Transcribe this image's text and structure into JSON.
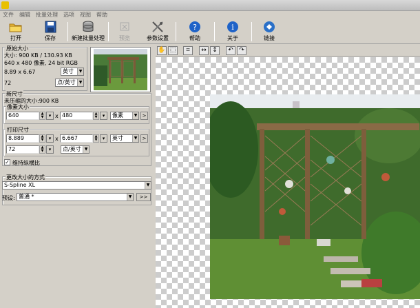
{
  "window": {
    "title": ""
  },
  "menu": [
    "文件",
    "编辑",
    "批量处理",
    "选项",
    "视图",
    "帮助"
  ],
  "toolbar": {
    "open": "打开",
    "save": "保存",
    "batch": "新建批量处理",
    "preview": "预览",
    "settings": "参数设置",
    "help": "帮助",
    "about": "关于",
    "link": "链接"
  },
  "original": {
    "title": "原始大小",
    "size_line": "大小: 900 KB / 130.93 KB",
    "pixel_line": "640 x 480 像素, 24 bit RGB",
    "dims": "8.89 x 6.67",
    "dims_unit": "英寸",
    "res": "72",
    "res_unit": "点/英寸"
  },
  "newsize": {
    "title": "新尺寸",
    "uncompressed": "未压缩的大小:900 KB",
    "pixel_title": "像素大小",
    "width_px": "640",
    "times": "x",
    "height_px": "480",
    "px_unit": "像素",
    "print_title": "打印尺寸",
    "width_in": "8.889",
    "height_in": "6.667",
    "in_unit": "英寸",
    "dpi": "72",
    "dpi_unit": "点/英寸",
    "keep_ratio": "维持纵横比",
    "arrow": ">"
  },
  "method": {
    "title": "更改大小的方式",
    "value": "S-Spline XL",
    "preset_label": "预设:",
    "preset_value": "普通 *",
    "more": ">>"
  },
  "colors": {
    "panel": "#d4d0c8",
    "help_blue": "#1f63c8",
    "link_blue": "#2a70c8"
  }
}
